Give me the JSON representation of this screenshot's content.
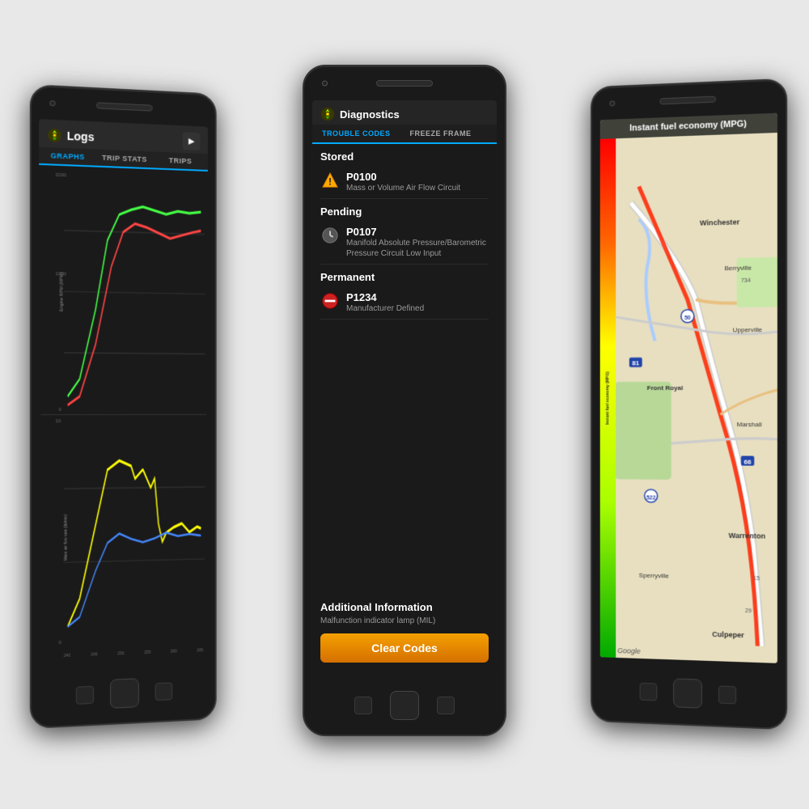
{
  "scene": {
    "background": "#e0e0e0"
  },
  "phone_left": {
    "title": "Logs",
    "tabs": [
      "GRAPHS",
      "TRIP STATS",
      "TRIPS"
    ],
    "active_tab": "GRAPHS",
    "y_label_top": "Engine RPM (RPM)",
    "y_label_bottom": "Mass air flow rate (lb/min)",
    "x_labels": [
      "240",
      "245",
      "250",
      "255",
      "260",
      "265"
    ]
  },
  "phone_center": {
    "title": "Diagnostics",
    "tabs": [
      "TROUBLE CODES",
      "FREEZE FRAME"
    ],
    "active_tab": "TROUBLE CODES",
    "sections": {
      "stored": {
        "label": "Stored",
        "codes": [
          {
            "code": "P0100",
            "description": "Mass or Volume Air Flow Circuit",
            "icon": "warning"
          }
        ]
      },
      "pending": {
        "label": "Pending",
        "codes": [
          {
            "code": "P0107",
            "description": "Manifold Absolute Pressure/Barometric Pressure Circuit Low Input",
            "icon": "clock"
          }
        ]
      },
      "permanent": {
        "label": "Permanent",
        "codes": [
          {
            "code": "P1234",
            "description": "Manufacturer Defined",
            "icon": "prohibited"
          }
        ]
      }
    },
    "additional_info": {
      "title": "Additional Information",
      "description": "Malfunction indicator lamp (MIL)"
    },
    "clear_codes_label": "Clear Codes"
  },
  "phone_right": {
    "title": "Instant fuel economy (MPG)",
    "map_cities": [
      "Winchester",
      "Berryville",
      "Front Royal",
      "Upperville",
      "Marshall",
      "Warrenton",
      "Sperryville",
      "Culpeper"
    ],
    "routes": [
      "81",
      "66",
      "50",
      "522",
      "29",
      "15",
      "734"
    ],
    "google_label": "Google"
  }
}
